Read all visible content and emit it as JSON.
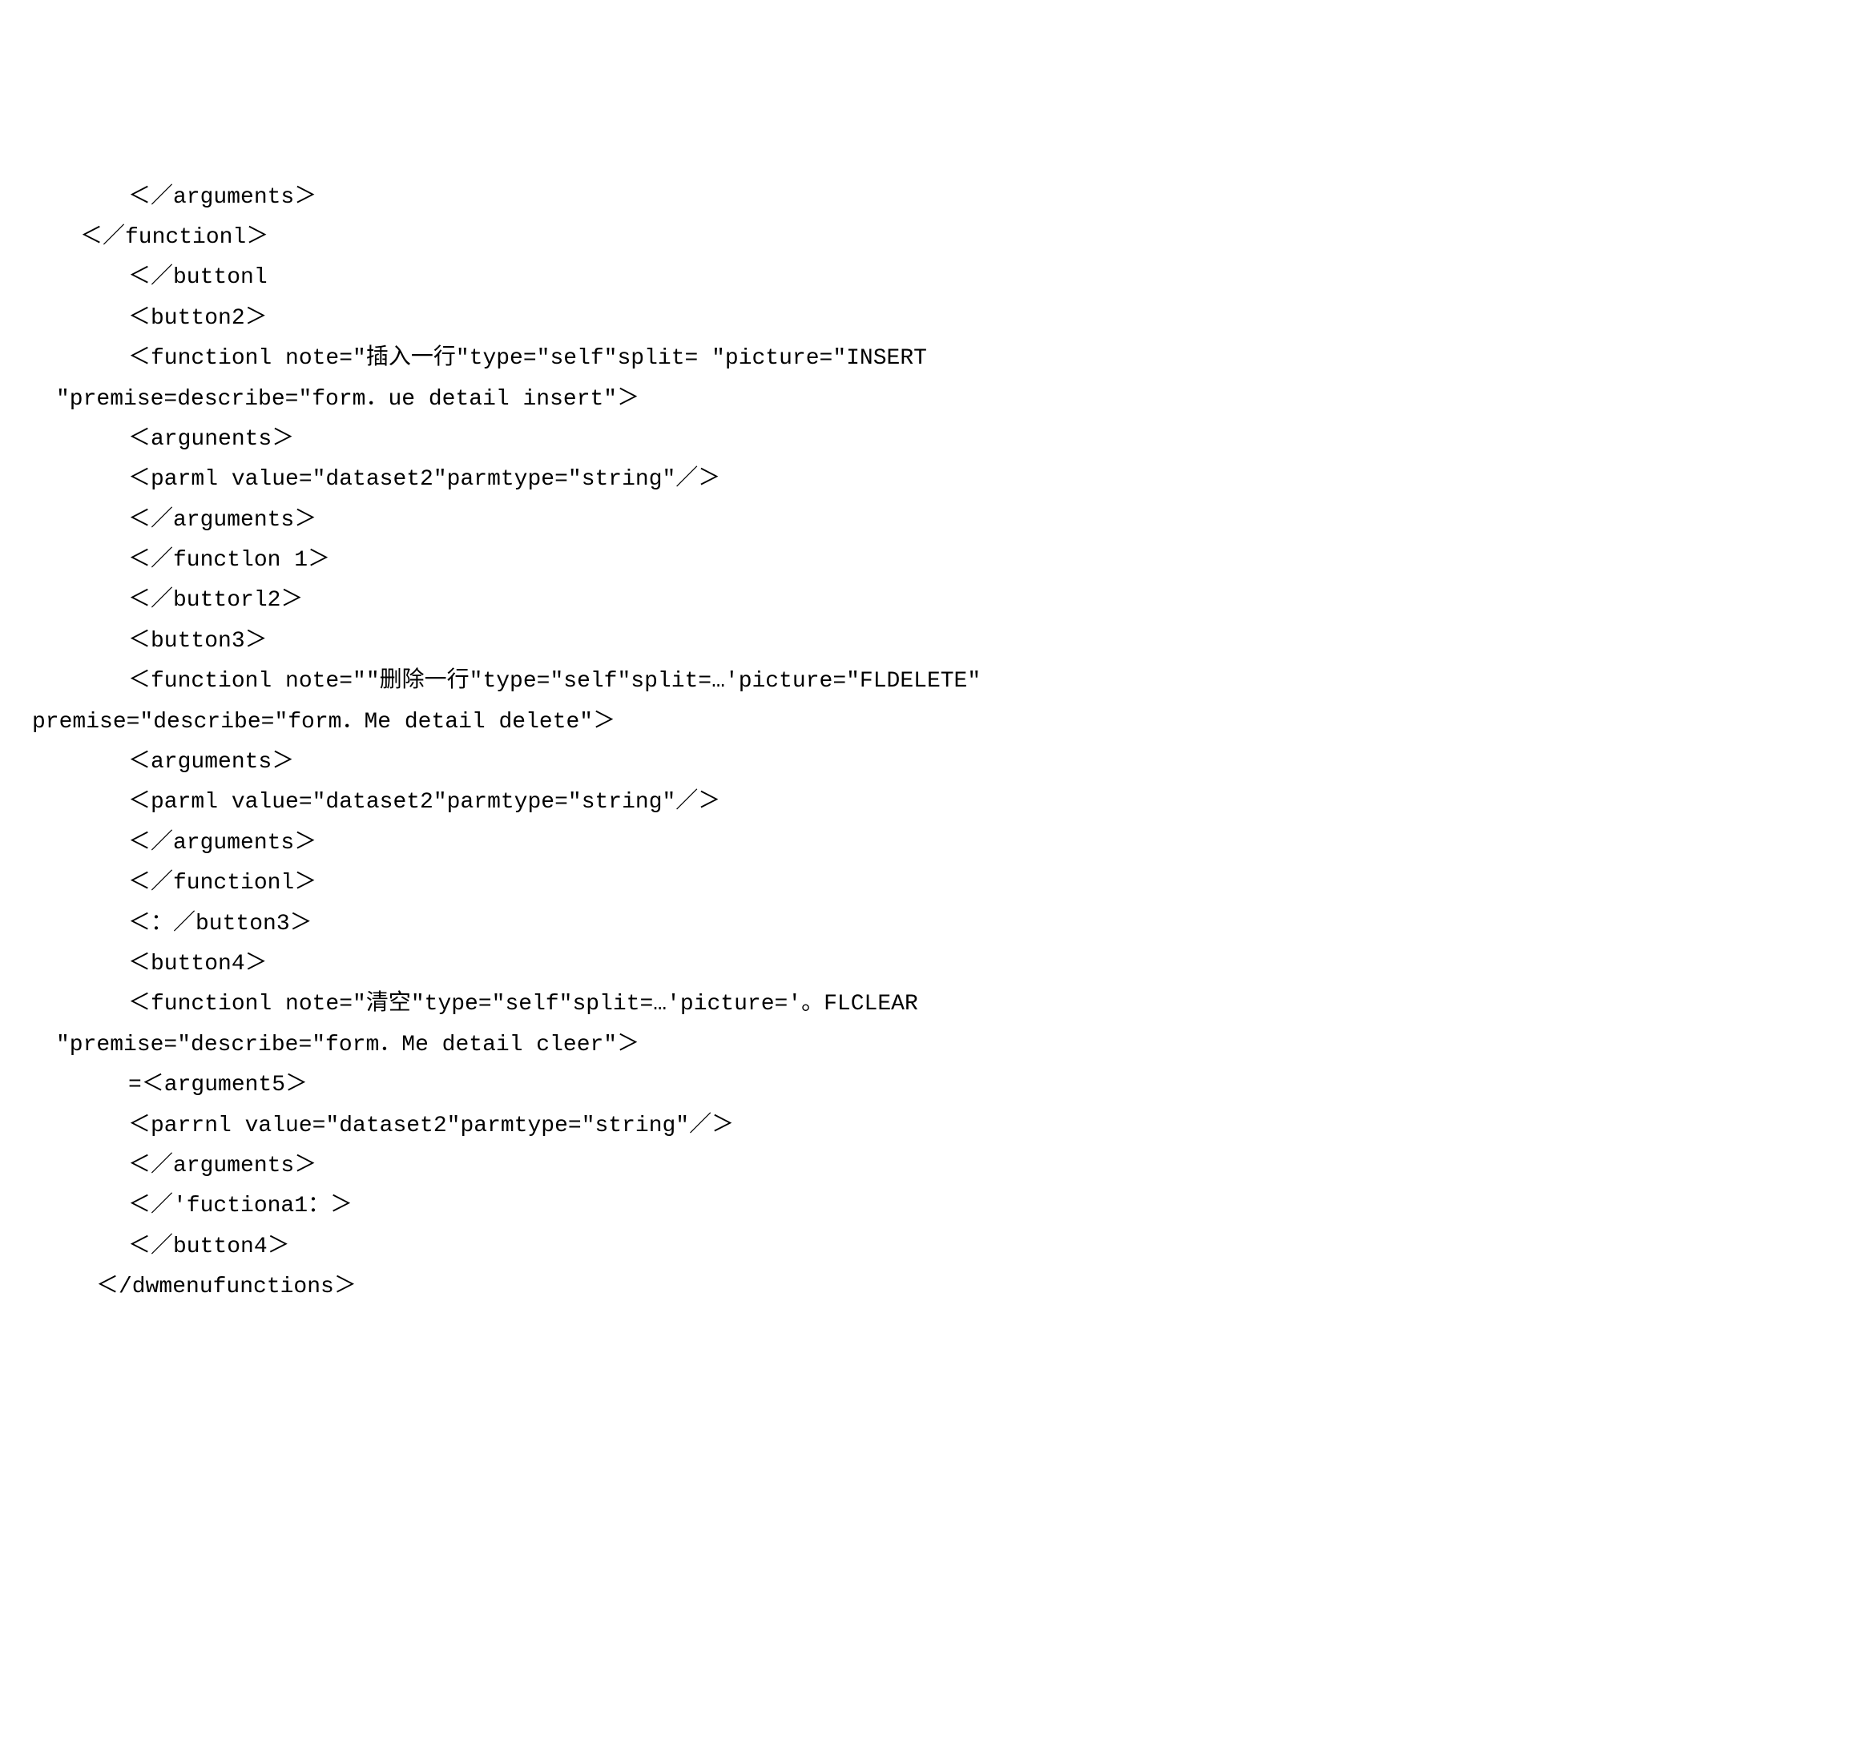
{
  "lines": [
    {
      "text": "＜／arguments＞",
      "class": "indent2"
    },
    {
      "text": "＜／functionl＞",
      "class": "indent1"
    },
    {
      "text": "＜／buttonl",
      "class": "indent2"
    },
    {
      "text": "＜button2＞",
      "class": "indent2"
    },
    {
      "text": "＜functionl note=\"插入一行\"type=\"self\"split= \"picture=\"INSERT",
      "class": "indent2"
    },
    {
      "text": "\"premise=describe=\"form．ue detail insert\"＞",
      "class": "wrap"
    },
    {
      "text": "＜argunents＞",
      "class": "indent2"
    },
    {
      "text": "＜parml value=\"dataset2\"parmtype=\"string\"／＞",
      "class": "indent2"
    },
    {
      "text": "＜／arguments＞",
      "class": "indent2"
    },
    {
      "text": "＜／functlon 1＞",
      "class": "indent2"
    },
    {
      "text": "＜／buttorl2＞",
      "class": "indent2"
    },
    {
      "text": "＜button3＞",
      "class": "indent2"
    },
    {
      "text": "＜functionl note=\"\"删除一行\"type=\"self\"split=…'picture=\"FLDELETE\"",
      "class": "indent2"
    },
    {
      "text": "premise=\"describe=\"form．Me detail delete\"＞",
      "class": "noindent"
    },
    {
      "text": "＜arguments＞",
      "class": "indent2"
    },
    {
      "text": "＜parml value=\"dataset2\"parmtype=\"string\"／＞",
      "class": "indent2"
    },
    {
      "text": "＜／arguments＞",
      "class": "indent2"
    },
    {
      "text": "＜／functionl＞",
      "class": "indent2"
    },
    {
      "text": "＜：／button3＞",
      "class": "indent2"
    },
    {
      "text": "＜button4＞",
      "class": "indent2"
    },
    {
      "text": "＜functionl note=\"清空\"type=\"self\"split=…'picture='。FLCLEAR",
      "class": "indent2"
    },
    {
      "text": "\"premise=\"describe=\"form．Me detail cleer\"＞",
      "class": "wrap"
    },
    {
      "text": "=＜argument5＞",
      "class": "indent2"
    },
    {
      "text": "＜parrnl value=\"dataset2\"parmtype=\"string\"／＞",
      "class": "indent2"
    },
    {
      "text": "＜／arguments＞",
      "class": "indent2"
    },
    {
      "text": "＜／'fuctiona1：＞",
      "class": "indent2"
    },
    {
      "text": "＜／button4＞",
      "class": "indent2"
    },
    {
      "text": "＜/dwmenufunctions＞",
      "class": "indent3"
    }
  ]
}
